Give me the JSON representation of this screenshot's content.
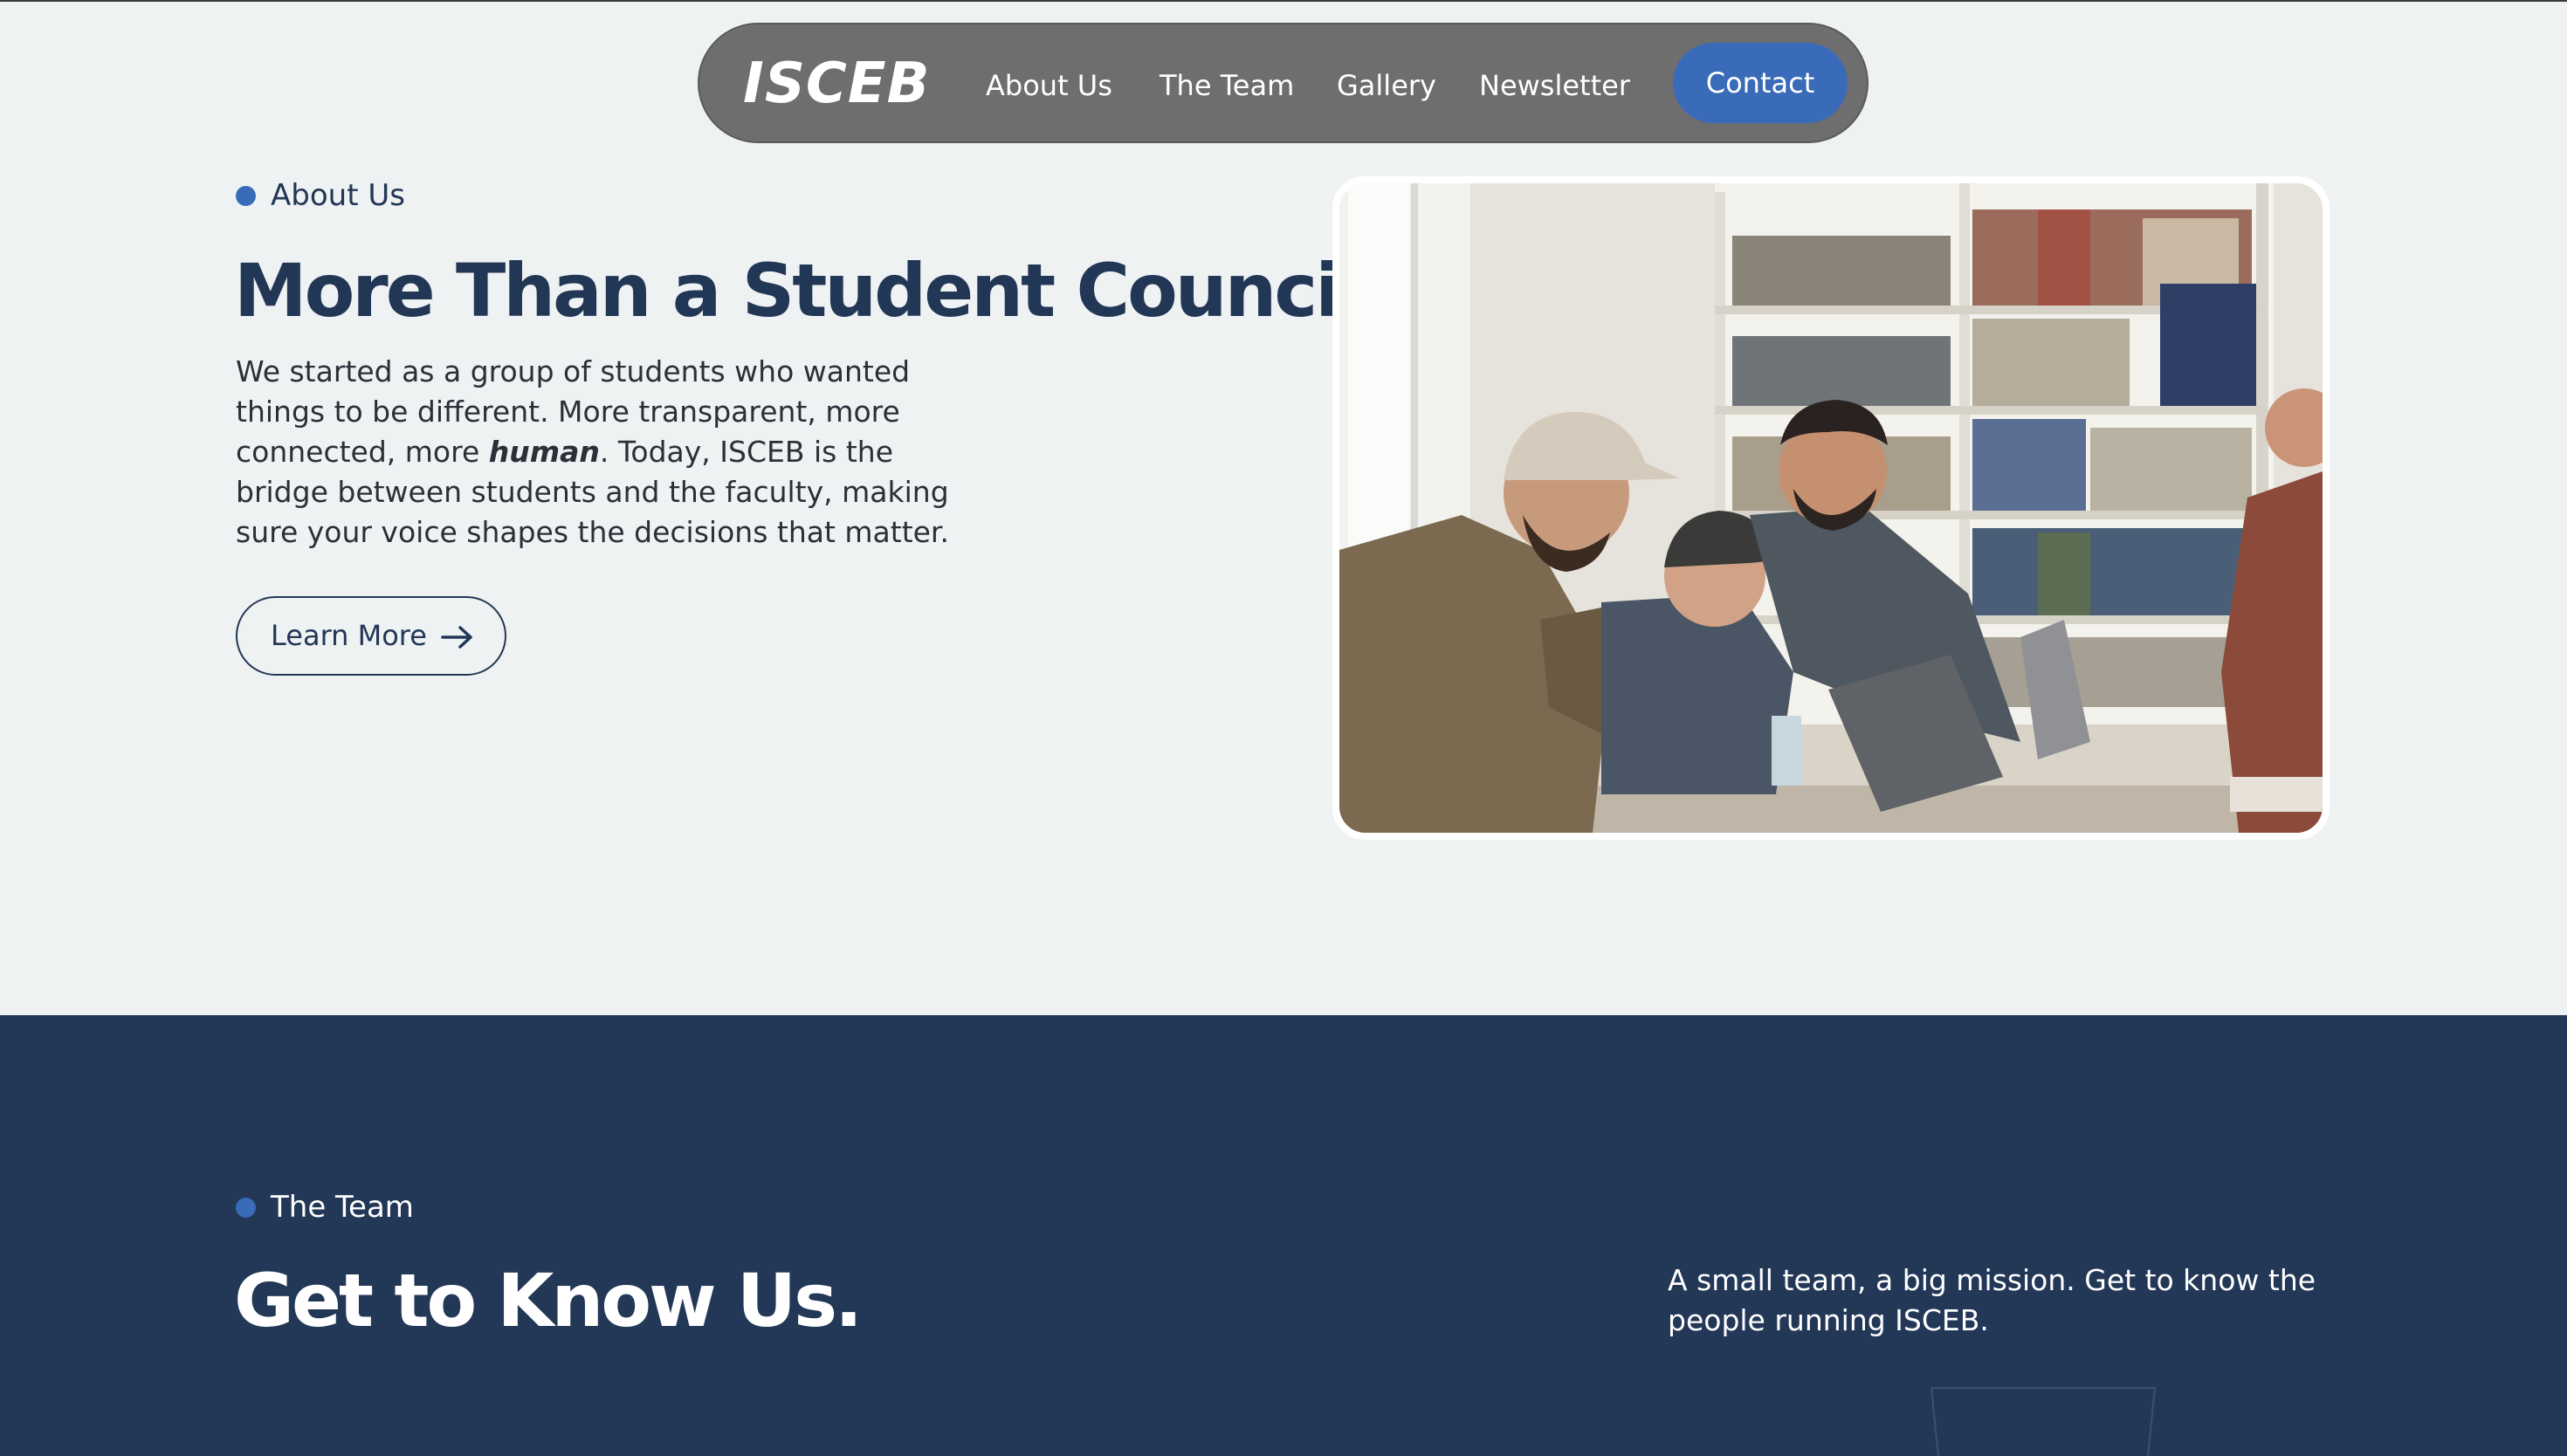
{
  "nav": {
    "logo": "ISCEB",
    "links": [
      "About Us",
      "The Team",
      "Gallery",
      "Newsletter"
    ],
    "contact_label": "Contact"
  },
  "about": {
    "eyebrow": "About Us",
    "title": "More Than a Student Council",
    "body_before": "We started as a group of students who wanted things to be different. More transparent, more connected, more ",
    "body_emphasis": "human",
    "body_after": ". Today, ISCEB is the bridge between students and the faculty, making sure your voice shapes the decisions that matter.",
    "button_label": "Learn More"
  },
  "team": {
    "eyebrow": "The Team",
    "title": "Get to Know Us.",
    "description": "A small team, a big mission. Get to know the people running ISCEB."
  },
  "colors": {
    "accent": "#3a6bb8",
    "navy": "#223655",
    "page_bg": "#eff2f3",
    "nav_bg": "#6e6e6e"
  }
}
